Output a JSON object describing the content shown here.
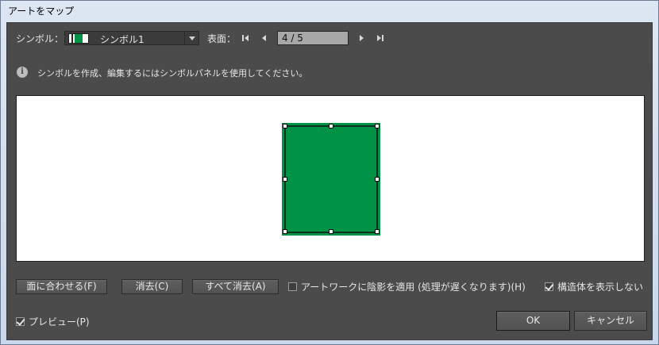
{
  "window": {
    "title": "アートをマップ"
  },
  "symbol": {
    "label": "シンボル：",
    "selected": "シンボル1"
  },
  "surface": {
    "label": "表面：",
    "page": "4 / 5"
  },
  "info": {
    "text": "シンボルを作成、編集するにはシンボルパネルを使用してください。"
  },
  "preview": {
    "art_color": "#009245"
  },
  "buttons": {
    "fit": "面に合わせる(F)",
    "clear": "消去(C)",
    "clear_all": "すべて消去(A)",
    "ok": "OK",
    "cancel": "キャンセル"
  },
  "options": {
    "shade_label": "アートワークに陰影を適用 (処理が遅くなります)(H)",
    "shade_checked": false,
    "hide_geometry_label": "構造体を表示しない",
    "hide_geometry_checked": true,
    "preview_label": "プレビュー(P)",
    "preview_checked": true
  }
}
